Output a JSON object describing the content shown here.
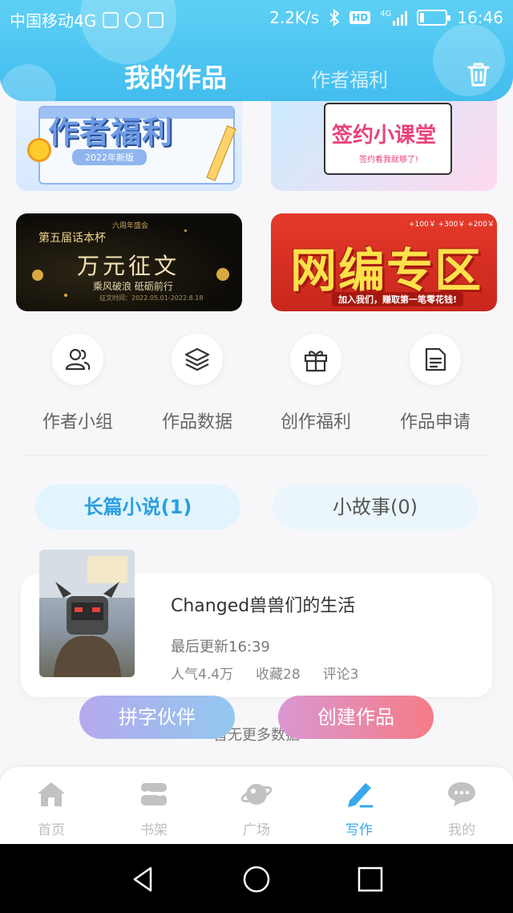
{
  "status_bar": {
    "carrier": "中国移动4G",
    "speed": "2.2K/s",
    "hd": "HD",
    "network": "4G",
    "time": "16:46",
    "battery_level": 0.15
  },
  "header": {
    "tab_active": "我的作品",
    "tab_inactive": "作者福利",
    "delete_icon": "trash-icon"
  },
  "banners": {
    "b1": {
      "title": "作者福利",
      "sub": "2022年新版"
    },
    "b2": {
      "title": "签约小课堂",
      "sub": "签约看我就够了!"
    },
    "b3": {
      "top": "六周年盛会",
      "line1": "第五届话本杯",
      "title": "万元征文",
      "sub": "乘风破浪 砥砺前行",
      "date": "征文时间：2022.05.01-2022.8.18"
    },
    "b4": {
      "title": "网编专区",
      "sub": "加入我们，赚取第一笔零花钱!",
      "top": "+100￥  +300￥  +200￥"
    }
  },
  "features": [
    {
      "label": "作者小组",
      "icon": "group-icon"
    },
    {
      "label": "作品数据",
      "icon": "layers-icon"
    },
    {
      "label": "创作福利",
      "icon": "gift-icon"
    },
    {
      "label": "作品申请",
      "icon": "document-icon"
    }
  ],
  "categories": {
    "novel": "长篇小说(1)",
    "story": "小故事(0)"
  },
  "works": [
    {
      "title": "Changed兽兽们的生活",
      "update": "最后更新16:39",
      "popularity": "人气4.4万",
      "favorites": "收藏28",
      "comments": "评论3"
    }
  ],
  "no_more": "暂无更多数据",
  "actions": {
    "partner": "拼字伙伴",
    "create": "创建作品"
  },
  "bottom_nav": [
    {
      "label": "首页",
      "icon": "home-icon"
    },
    {
      "label": "书架",
      "icon": "bookshelf-icon"
    },
    {
      "label": "广场",
      "icon": "planet-icon"
    },
    {
      "label": "写作",
      "icon": "pen-icon",
      "active": true
    },
    {
      "label": "我的",
      "icon": "chat-icon"
    }
  ],
  "colors": {
    "header": "#4cc4f1",
    "accent": "#37a8ec",
    "fab_left": "#b5a9ec",
    "fab_right": "#f57c86"
  }
}
